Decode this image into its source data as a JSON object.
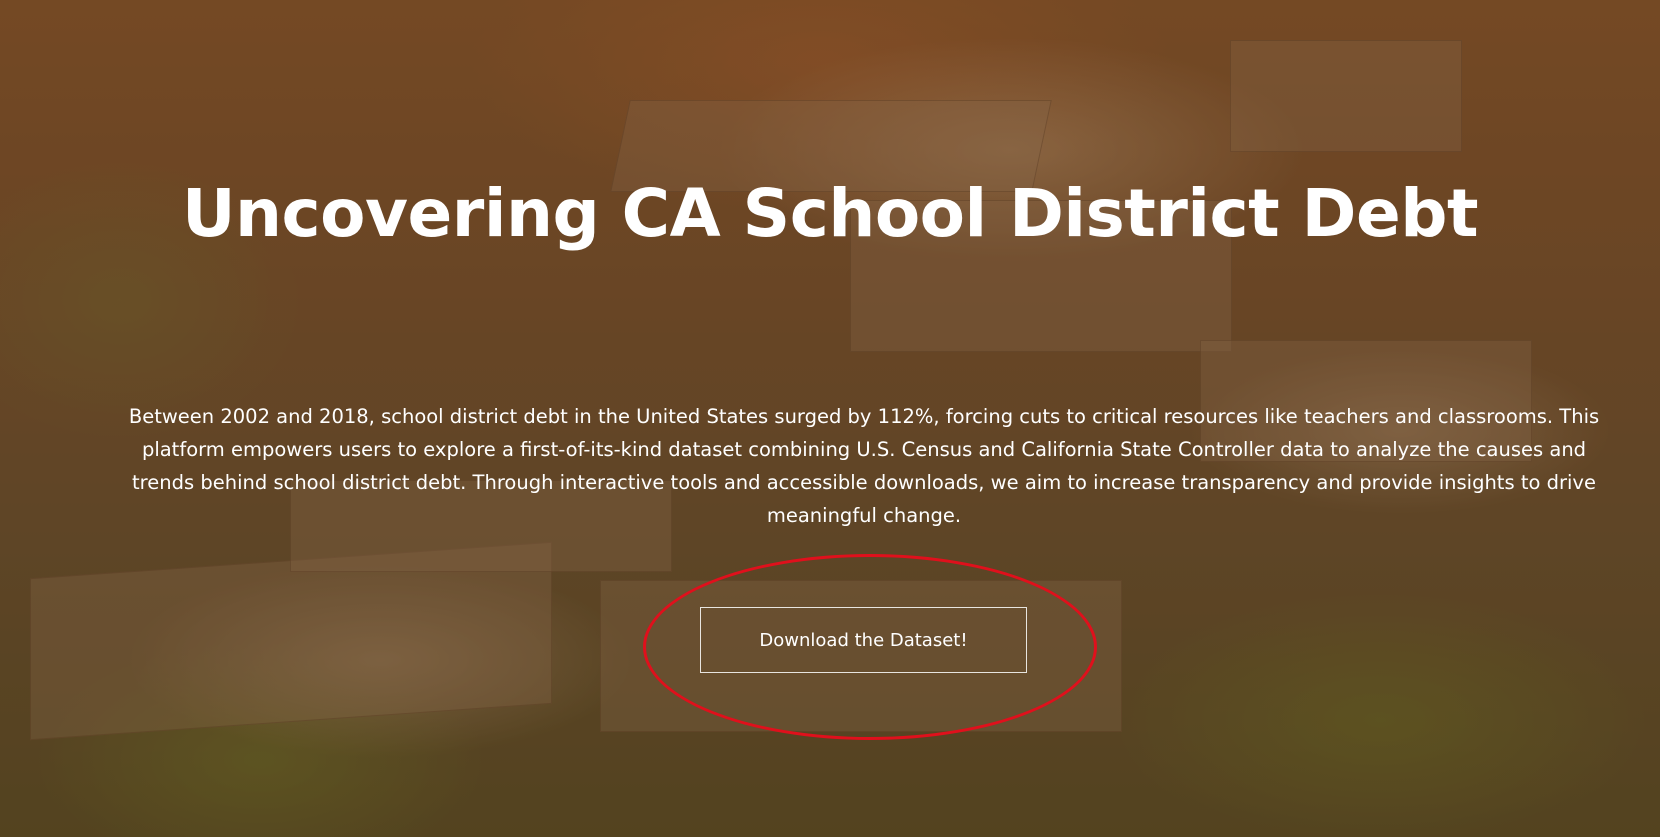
{
  "hero": {
    "title": "Uncovering CA School District Debt",
    "description": "Between 2002 and 2018, school district debt in the United States surged by 112%, forcing cuts to critical resources like teachers and classrooms. This platform empowers users to explore a first-of-its-kind dataset combining U.S. Census and California State Controller data to analyze the causes and trends behind school district debt. Through interactive tools and accessible downloads, we aim to increase transparency and provide insights to drive meaningful change.",
    "cta_label": "Download the Dataset!"
  },
  "colors": {
    "text": "#ffffff",
    "highlight_ellipse": "#e0101c",
    "overlay_tint": "#6e4a2a"
  }
}
